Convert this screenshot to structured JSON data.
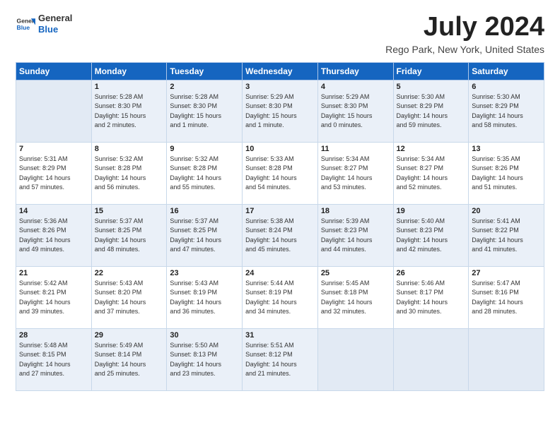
{
  "header": {
    "logo_general": "General",
    "logo_blue": "Blue",
    "month_title": "July 2024",
    "location": "Rego Park, New York, United States"
  },
  "days_of_week": [
    "Sunday",
    "Monday",
    "Tuesday",
    "Wednesday",
    "Thursday",
    "Friday",
    "Saturday"
  ],
  "weeks": [
    [
      {
        "day": "",
        "info": ""
      },
      {
        "day": "1",
        "info": "Sunrise: 5:28 AM\nSunset: 8:30 PM\nDaylight: 15 hours\nand 2 minutes."
      },
      {
        "day": "2",
        "info": "Sunrise: 5:28 AM\nSunset: 8:30 PM\nDaylight: 15 hours\nand 1 minute."
      },
      {
        "day": "3",
        "info": "Sunrise: 5:29 AM\nSunset: 8:30 PM\nDaylight: 15 hours\nand 1 minute."
      },
      {
        "day": "4",
        "info": "Sunrise: 5:29 AM\nSunset: 8:30 PM\nDaylight: 15 hours\nand 0 minutes."
      },
      {
        "day": "5",
        "info": "Sunrise: 5:30 AM\nSunset: 8:29 PM\nDaylight: 14 hours\nand 59 minutes."
      },
      {
        "day": "6",
        "info": "Sunrise: 5:30 AM\nSunset: 8:29 PM\nDaylight: 14 hours\nand 58 minutes."
      }
    ],
    [
      {
        "day": "7",
        "info": "Sunrise: 5:31 AM\nSunset: 8:29 PM\nDaylight: 14 hours\nand 57 minutes."
      },
      {
        "day": "8",
        "info": "Sunrise: 5:32 AM\nSunset: 8:28 PM\nDaylight: 14 hours\nand 56 minutes."
      },
      {
        "day": "9",
        "info": "Sunrise: 5:32 AM\nSunset: 8:28 PM\nDaylight: 14 hours\nand 55 minutes."
      },
      {
        "day": "10",
        "info": "Sunrise: 5:33 AM\nSunset: 8:28 PM\nDaylight: 14 hours\nand 54 minutes."
      },
      {
        "day": "11",
        "info": "Sunrise: 5:34 AM\nSunset: 8:27 PM\nDaylight: 14 hours\nand 53 minutes."
      },
      {
        "day": "12",
        "info": "Sunrise: 5:34 AM\nSunset: 8:27 PM\nDaylight: 14 hours\nand 52 minutes."
      },
      {
        "day": "13",
        "info": "Sunrise: 5:35 AM\nSunset: 8:26 PM\nDaylight: 14 hours\nand 51 minutes."
      }
    ],
    [
      {
        "day": "14",
        "info": "Sunrise: 5:36 AM\nSunset: 8:26 PM\nDaylight: 14 hours\nand 49 minutes."
      },
      {
        "day": "15",
        "info": "Sunrise: 5:37 AM\nSunset: 8:25 PM\nDaylight: 14 hours\nand 48 minutes."
      },
      {
        "day": "16",
        "info": "Sunrise: 5:37 AM\nSunset: 8:25 PM\nDaylight: 14 hours\nand 47 minutes."
      },
      {
        "day": "17",
        "info": "Sunrise: 5:38 AM\nSunset: 8:24 PM\nDaylight: 14 hours\nand 45 minutes."
      },
      {
        "day": "18",
        "info": "Sunrise: 5:39 AM\nSunset: 8:23 PM\nDaylight: 14 hours\nand 44 minutes."
      },
      {
        "day": "19",
        "info": "Sunrise: 5:40 AM\nSunset: 8:23 PM\nDaylight: 14 hours\nand 42 minutes."
      },
      {
        "day": "20",
        "info": "Sunrise: 5:41 AM\nSunset: 8:22 PM\nDaylight: 14 hours\nand 41 minutes."
      }
    ],
    [
      {
        "day": "21",
        "info": "Sunrise: 5:42 AM\nSunset: 8:21 PM\nDaylight: 14 hours\nand 39 minutes."
      },
      {
        "day": "22",
        "info": "Sunrise: 5:43 AM\nSunset: 8:20 PM\nDaylight: 14 hours\nand 37 minutes."
      },
      {
        "day": "23",
        "info": "Sunrise: 5:43 AM\nSunset: 8:19 PM\nDaylight: 14 hours\nand 36 minutes."
      },
      {
        "day": "24",
        "info": "Sunrise: 5:44 AM\nSunset: 8:19 PM\nDaylight: 14 hours\nand 34 minutes."
      },
      {
        "day": "25",
        "info": "Sunrise: 5:45 AM\nSunset: 8:18 PM\nDaylight: 14 hours\nand 32 minutes."
      },
      {
        "day": "26",
        "info": "Sunrise: 5:46 AM\nSunset: 8:17 PM\nDaylight: 14 hours\nand 30 minutes."
      },
      {
        "day": "27",
        "info": "Sunrise: 5:47 AM\nSunset: 8:16 PM\nDaylight: 14 hours\nand 28 minutes."
      }
    ],
    [
      {
        "day": "28",
        "info": "Sunrise: 5:48 AM\nSunset: 8:15 PM\nDaylight: 14 hours\nand 27 minutes."
      },
      {
        "day": "29",
        "info": "Sunrise: 5:49 AM\nSunset: 8:14 PM\nDaylight: 14 hours\nand 25 minutes."
      },
      {
        "day": "30",
        "info": "Sunrise: 5:50 AM\nSunset: 8:13 PM\nDaylight: 14 hours\nand 23 minutes."
      },
      {
        "day": "31",
        "info": "Sunrise: 5:51 AM\nSunset: 8:12 PM\nDaylight: 14 hours\nand 21 minutes."
      },
      {
        "day": "",
        "info": ""
      },
      {
        "day": "",
        "info": ""
      },
      {
        "day": "",
        "info": ""
      }
    ]
  ]
}
